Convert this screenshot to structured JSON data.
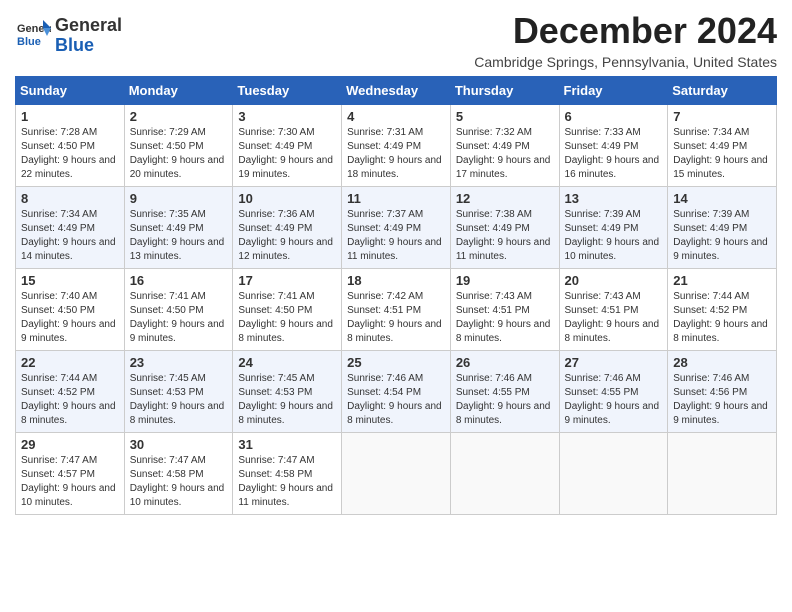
{
  "header": {
    "logo_general": "General",
    "logo_blue": "Blue",
    "month_title": "December 2024",
    "location": "Cambridge Springs, Pennsylvania, United States"
  },
  "weekdays": [
    "Sunday",
    "Monday",
    "Tuesday",
    "Wednesday",
    "Thursday",
    "Friday",
    "Saturday"
  ],
  "weeks": [
    [
      {
        "day": "1",
        "sunrise": "Sunrise: 7:28 AM",
        "sunset": "Sunset: 4:50 PM",
        "daylight": "Daylight: 9 hours and 22 minutes."
      },
      {
        "day": "2",
        "sunrise": "Sunrise: 7:29 AM",
        "sunset": "Sunset: 4:50 PM",
        "daylight": "Daylight: 9 hours and 20 minutes."
      },
      {
        "day": "3",
        "sunrise": "Sunrise: 7:30 AM",
        "sunset": "Sunset: 4:49 PM",
        "daylight": "Daylight: 9 hours and 19 minutes."
      },
      {
        "day": "4",
        "sunrise": "Sunrise: 7:31 AM",
        "sunset": "Sunset: 4:49 PM",
        "daylight": "Daylight: 9 hours and 18 minutes."
      },
      {
        "day": "5",
        "sunrise": "Sunrise: 7:32 AM",
        "sunset": "Sunset: 4:49 PM",
        "daylight": "Daylight: 9 hours and 17 minutes."
      },
      {
        "day": "6",
        "sunrise": "Sunrise: 7:33 AM",
        "sunset": "Sunset: 4:49 PM",
        "daylight": "Daylight: 9 hours and 16 minutes."
      },
      {
        "day": "7",
        "sunrise": "Sunrise: 7:34 AM",
        "sunset": "Sunset: 4:49 PM",
        "daylight": "Daylight: 9 hours and 15 minutes."
      }
    ],
    [
      {
        "day": "8",
        "sunrise": "Sunrise: 7:34 AM",
        "sunset": "Sunset: 4:49 PM",
        "daylight": "Daylight: 9 hours and 14 minutes."
      },
      {
        "day": "9",
        "sunrise": "Sunrise: 7:35 AM",
        "sunset": "Sunset: 4:49 PM",
        "daylight": "Daylight: 9 hours and 13 minutes."
      },
      {
        "day": "10",
        "sunrise": "Sunrise: 7:36 AM",
        "sunset": "Sunset: 4:49 PM",
        "daylight": "Daylight: 9 hours and 12 minutes."
      },
      {
        "day": "11",
        "sunrise": "Sunrise: 7:37 AM",
        "sunset": "Sunset: 4:49 PM",
        "daylight": "Daylight: 9 hours and 11 minutes."
      },
      {
        "day": "12",
        "sunrise": "Sunrise: 7:38 AM",
        "sunset": "Sunset: 4:49 PM",
        "daylight": "Daylight: 9 hours and 11 minutes."
      },
      {
        "day": "13",
        "sunrise": "Sunrise: 7:39 AM",
        "sunset": "Sunset: 4:49 PM",
        "daylight": "Daylight: 9 hours and 10 minutes."
      },
      {
        "day": "14",
        "sunrise": "Sunrise: 7:39 AM",
        "sunset": "Sunset: 4:49 PM",
        "daylight": "Daylight: 9 hours and 9 minutes."
      }
    ],
    [
      {
        "day": "15",
        "sunrise": "Sunrise: 7:40 AM",
        "sunset": "Sunset: 4:50 PM",
        "daylight": "Daylight: 9 hours and 9 minutes."
      },
      {
        "day": "16",
        "sunrise": "Sunrise: 7:41 AM",
        "sunset": "Sunset: 4:50 PM",
        "daylight": "Daylight: 9 hours and 9 minutes."
      },
      {
        "day": "17",
        "sunrise": "Sunrise: 7:41 AM",
        "sunset": "Sunset: 4:50 PM",
        "daylight": "Daylight: 9 hours and 8 minutes."
      },
      {
        "day": "18",
        "sunrise": "Sunrise: 7:42 AM",
        "sunset": "Sunset: 4:51 PM",
        "daylight": "Daylight: 9 hours and 8 minutes."
      },
      {
        "day": "19",
        "sunrise": "Sunrise: 7:43 AM",
        "sunset": "Sunset: 4:51 PM",
        "daylight": "Daylight: 9 hours and 8 minutes."
      },
      {
        "day": "20",
        "sunrise": "Sunrise: 7:43 AM",
        "sunset": "Sunset: 4:51 PM",
        "daylight": "Daylight: 9 hours and 8 minutes."
      },
      {
        "day": "21",
        "sunrise": "Sunrise: 7:44 AM",
        "sunset": "Sunset: 4:52 PM",
        "daylight": "Daylight: 9 hours and 8 minutes."
      }
    ],
    [
      {
        "day": "22",
        "sunrise": "Sunrise: 7:44 AM",
        "sunset": "Sunset: 4:52 PM",
        "daylight": "Daylight: 9 hours and 8 minutes."
      },
      {
        "day": "23",
        "sunrise": "Sunrise: 7:45 AM",
        "sunset": "Sunset: 4:53 PM",
        "daylight": "Daylight: 9 hours and 8 minutes."
      },
      {
        "day": "24",
        "sunrise": "Sunrise: 7:45 AM",
        "sunset": "Sunset: 4:53 PM",
        "daylight": "Daylight: 9 hours and 8 minutes."
      },
      {
        "day": "25",
        "sunrise": "Sunrise: 7:46 AM",
        "sunset": "Sunset: 4:54 PM",
        "daylight": "Daylight: 9 hours and 8 minutes."
      },
      {
        "day": "26",
        "sunrise": "Sunrise: 7:46 AM",
        "sunset": "Sunset: 4:55 PM",
        "daylight": "Daylight: 9 hours and 8 minutes."
      },
      {
        "day": "27",
        "sunrise": "Sunrise: 7:46 AM",
        "sunset": "Sunset: 4:55 PM",
        "daylight": "Daylight: 9 hours and 9 minutes."
      },
      {
        "day": "28",
        "sunrise": "Sunrise: 7:46 AM",
        "sunset": "Sunset: 4:56 PM",
        "daylight": "Daylight: 9 hours and 9 minutes."
      }
    ],
    [
      {
        "day": "29",
        "sunrise": "Sunrise: 7:47 AM",
        "sunset": "Sunset: 4:57 PM",
        "daylight": "Daylight: 9 hours and 10 minutes."
      },
      {
        "day": "30",
        "sunrise": "Sunrise: 7:47 AM",
        "sunset": "Sunset: 4:58 PM",
        "daylight": "Daylight: 9 hours and 10 minutes."
      },
      {
        "day": "31",
        "sunrise": "Sunrise: 7:47 AM",
        "sunset": "Sunset: 4:58 PM",
        "daylight": "Daylight: 9 hours and 11 minutes."
      },
      null,
      null,
      null,
      null
    ]
  ]
}
